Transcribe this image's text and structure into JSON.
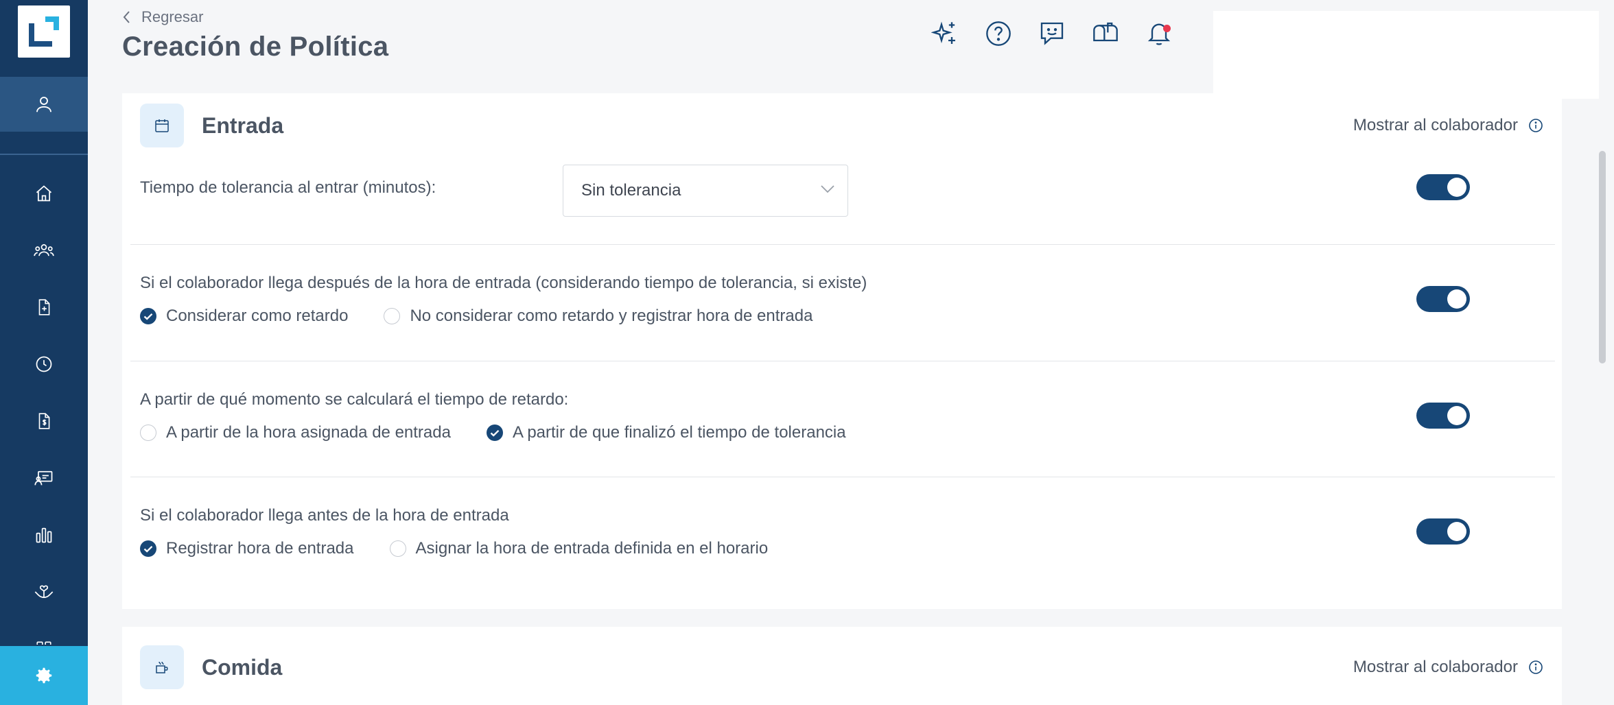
{
  "header": {
    "back_label": "Regresar",
    "title": "Creación de Política",
    "icons": [
      "sparkle-icon",
      "help-icon",
      "feedback-icon",
      "mailbox-icon",
      "bell-icon"
    ]
  },
  "sidebar": {
    "items": [
      "user-icon",
      "home-icon",
      "team-icon",
      "document-add-icon",
      "clock-icon",
      "payroll-icon",
      "training-icon",
      "chart-icon",
      "benefits-icon",
      "apps-icon"
    ],
    "settings": "gear-icon"
  },
  "sections": {
    "entrada": {
      "title": "Entrada",
      "show_label": "Mostrar al colaborador",
      "rows": {
        "tolerance": {
          "label": "Tiempo de tolerancia al entrar (minutos):",
          "select_value": "Sin tolerancia",
          "toggle_on": true
        },
        "late": {
          "label": "Si el colaborador llega después de la hora de entrada (considerando tiempo de tolerancia, si existe)",
          "option1": "Considerar como retardo",
          "option2": "No considerar como retardo y registrar hora de entrada",
          "selected": 1,
          "toggle_on": true
        },
        "calc": {
          "label": "A partir de qué momento se calculará el tiempo de retardo:",
          "option1": "A partir de la hora asignada de entrada",
          "option2": "A partir de que finalizó el tiempo de tolerancia",
          "selected": 2,
          "toggle_on": true
        },
        "early": {
          "label": "Si el colaborador llega antes de la hora de entrada",
          "option1": "Registrar hora de entrada",
          "option2": "Asignar la hora de entrada definida en el horario",
          "selected": 1,
          "toggle_on": true
        }
      }
    },
    "comida": {
      "title": "Comida",
      "show_label": "Mostrar al colaborador"
    }
  },
  "colors": {
    "sidebar": "#163a62",
    "sidebar_active": "#2b5683",
    "settings": "#29b1e0",
    "primary": "#174777",
    "notification": "#e8384f"
  }
}
